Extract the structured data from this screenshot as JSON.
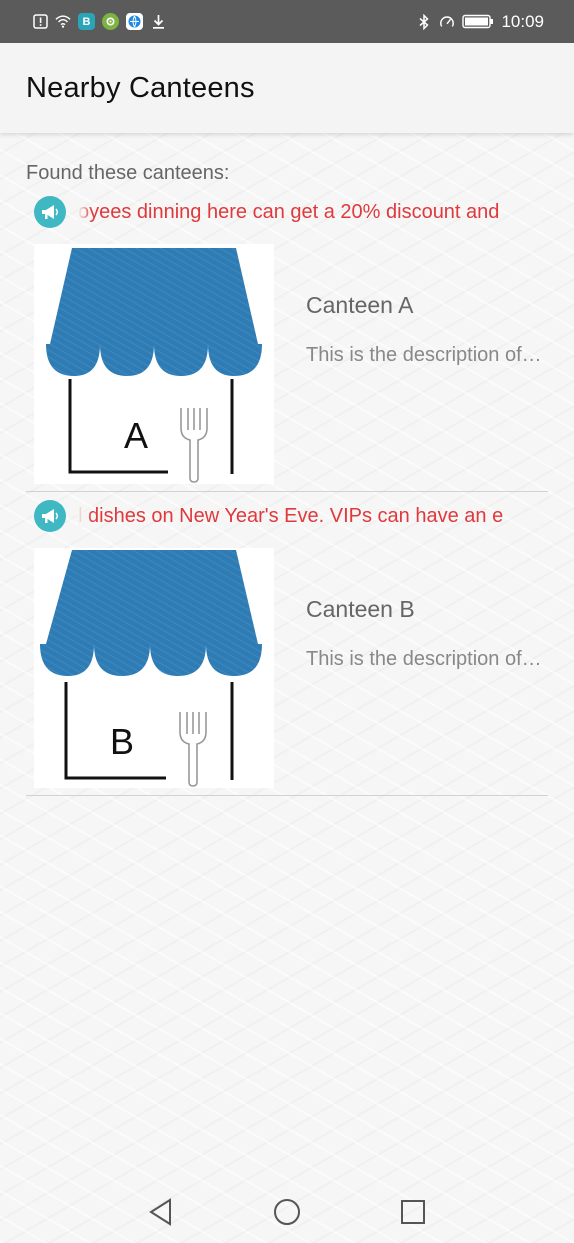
{
  "status_bar": {
    "time": "10:09",
    "left_icons": [
      "alert-icon",
      "wifi-icon",
      "app-b-icon",
      "app-gear-icon",
      "app-globe-icon",
      "download-icon"
    ],
    "right_icons": [
      "bluetooth-icon",
      "speed-icon",
      "battery-icon"
    ],
    "app_b_letter": "B"
  },
  "app_bar": {
    "title": "Nearby Canteens"
  },
  "found_label": "Found these canteens:",
  "notices": [
    {
      "text": "oyees dinning here can get a 20% discount and"
    },
    {
      "text": "l dishes on New Year's Eve. VIPs can have an e"
    }
  ],
  "canteens": [
    {
      "name": "Canteen A",
      "description": "This is the description of Canteen A",
      "letter": "A"
    },
    {
      "name": "Canteen B",
      "description": "This is the description of Canteen B",
      "letter": "B"
    }
  ],
  "colors": {
    "status_bar": "#5b5b5b",
    "notice_text": "#e0393c",
    "notice_icon": "#3fb8c4",
    "awning": "#2f7bb3"
  },
  "nav_bar": {
    "buttons": [
      "back-icon",
      "home-icon",
      "recents-icon"
    ]
  }
}
